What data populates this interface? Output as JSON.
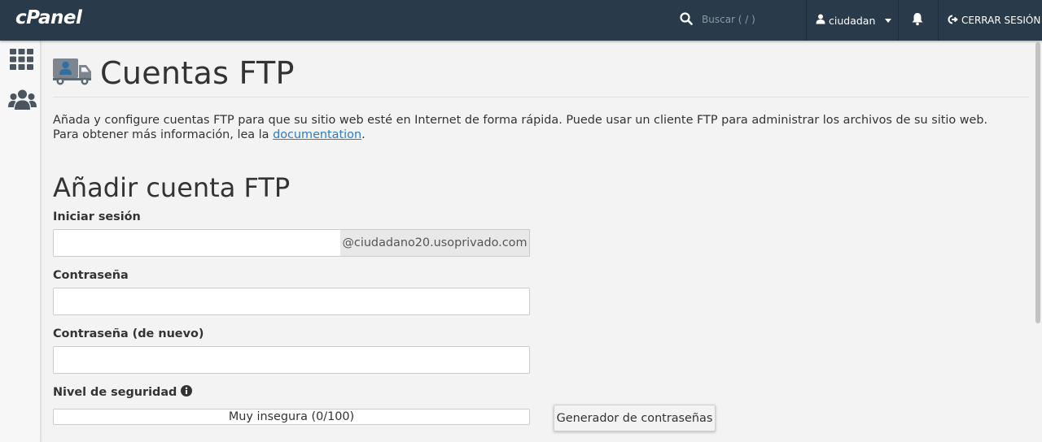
{
  "topbar": {
    "logo": "cPanel",
    "search_placeholder": "Buscar ( / )",
    "user_label": "ciudadan",
    "logout_label": "CERRAR SESIÓN",
    "bg_color": "#293a4a"
  },
  "sidebar": {
    "items": [
      {
        "icon": "grid-icon"
      },
      {
        "icon": "users-icon"
      }
    ]
  },
  "page": {
    "title": "Cuentas FTP",
    "description": "Añada y configure cuentas FTP para que su sitio web esté en Internet de forma rápida. Puede usar un cliente FTP para administrar los archivos de su sitio web. Para obtener más información, lea la ",
    "doc_link": "documentation",
    "description_end": "."
  },
  "form": {
    "section_title": "Añadir cuenta FTP",
    "login_label": "Iniciar sesión",
    "login_value": "",
    "domain_suffix": "@ciudadano20.usoprivado.com",
    "password_label": "Contraseña",
    "password_value": "",
    "password_again_label": "Contraseña (de nuevo)",
    "password_again_value": "",
    "strength_label": "Nivel de seguridad",
    "strength_text": "Muy insegura (0/100)",
    "strength_value": 0,
    "generator_button": "Generador de contraseñas"
  },
  "colors": {
    "link": "#2f7bbf",
    "page_bg": "#f3f3f3"
  }
}
